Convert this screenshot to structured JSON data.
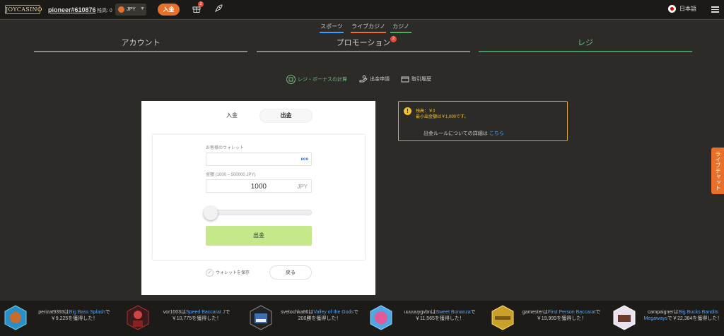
{
  "header": {
    "logo": "JOYCASINO",
    "username": "pioneer#610876",
    "balance_label": "残高: 0",
    "currency": "JPY",
    "deposit_label": "入金",
    "gift_badge": "2",
    "language": "日本語"
  },
  "subnav": [
    "スポーツ",
    "ライブカジノ",
    "カジノ"
  ],
  "tabs": [
    {
      "label": "アカウント"
    },
    {
      "label": "プロモーション",
      "badge": "2"
    },
    {
      "label": "レジ"
    }
  ],
  "cashier_tabs": [
    "レジ・ボーナスの計算",
    "出金申請",
    "取引履歴"
  ],
  "form": {
    "tab_deposit": "入金",
    "tab_withdraw": "出金",
    "wallet_label": "お客様のウォレット",
    "wallet_badge": "eco",
    "amount_label": "金額 (1000 – 500000 JPY)",
    "amount_value": "1000",
    "amount_unit": "JPY",
    "slider_value": 0,
    "submit": "出金",
    "save_wallet": "ウォレットを保存",
    "back": "戻る"
  },
  "info": {
    "balance": "残高：￥0",
    "min": "最小出金額は￥1,000です。",
    "rules": "出金ルールについての詳細は",
    "rules_link": "こちら"
  },
  "live_chat": "ライブチャット",
  "ticker": [
    {
      "user": "perizat9393は",
      "game": "Big Bass Splash",
      "rest": "で￥9,225を獲得した！"
    },
    {
      "user": "vor1003は",
      "game": "Speed Baccarat J",
      "rest": "で￥10,775を獲得した！"
    },
    {
      "user": "svetochka86は",
      "game": "Valley of the Gods",
      "rest": "で200勝を獲得した！"
    },
    {
      "user": "uuuuuygvbnは",
      "game": "Sweet Bonanza",
      "rest": "で￥11,565を獲得した！"
    },
    {
      "user": "gamesterは",
      "game": "First Person Baccarat",
      "rest": "で￥19,999を獲得した！"
    },
    {
      "user": "campaignerは",
      "game": "Big Bucks Bandits Megaways",
      "rest": "で￥22,384を獲得した！"
    }
  ]
}
